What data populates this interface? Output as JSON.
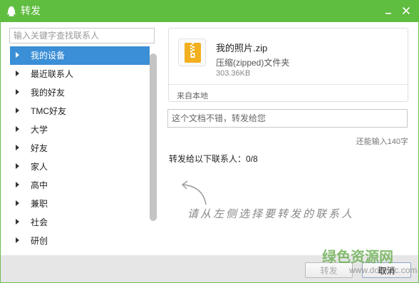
{
  "window": {
    "title": "转发"
  },
  "sidebar": {
    "search_placeholder": "输入关键字查找联系人",
    "groups": [
      {
        "label": "我的设备",
        "selected": true
      },
      {
        "label": "最近联系人"
      },
      {
        "label": "我的好友"
      },
      {
        "label": "TMC好友"
      },
      {
        "label": "大学"
      },
      {
        "label": "好友"
      },
      {
        "label": "家人"
      },
      {
        "label": "高中"
      },
      {
        "label": "兼职"
      },
      {
        "label": "社会"
      },
      {
        "label": "研创"
      }
    ]
  },
  "file": {
    "name": "我的照片.zip",
    "type": "压缩(zipped)文件夹",
    "size": "303.36KB",
    "source": "来自本地"
  },
  "message": {
    "placeholder": "这个文档不错，转发给您",
    "char_limit": "还能输入140字"
  },
  "forward": {
    "count_label": "转发给以下联系人：0/8",
    "hint": "请从左侧选择要转发的联系人"
  },
  "buttons": {
    "forward": "转发",
    "cancel": "取消"
  },
  "watermark": {
    "title": "绿色资源网",
    "url": "www.downcc.com"
  },
  "colors": {
    "titlebar": "#5fbd40",
    "selected": "#3b8fd6",
    "zip": "#f2b01e"
  }
}
